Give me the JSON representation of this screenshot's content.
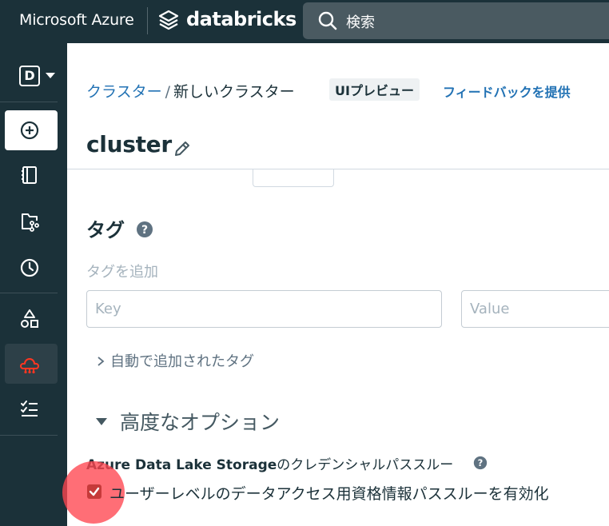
{
  "topbar": {
    "microsoft_azure": "Microsoft Azure",
    "databricks": "databricks",
    "search_placeholder": "検索"
  },
  "sidebar": {
    "workspace_initial": "D",
    "items": [
      {
        "icon": "plus-circle-icon",
        "selected": "create"
      },
      {
        "icon": "notebook-icon"
      },
      {
        "icon": "repos-icon"
      },
      {
        "icon": "clock-icon"
      },
      {
        "icon": "shapes-icon"
      },
      {
        "icon": "cluster-icon",
        "selected": "active"
      },
      {
        "icon": "checklist-icon"
      }
    ]
  },
  "header": {
    "breadcrumb_clusters": "クラスター",
    "breadcrumb_separator": "/",
    "breadcrumb_current": "新しいクラスター",
    "ui_preview": "UIプレビュー",
    "feedback": "フィードバックを提供",
    "title": "cluster"
  },
  "tags": {
    "title": "タグ",
    "subtitle": "タグを追加",
    "key_placeholder": "Key",
    "value_placeholder": "Value",
    "auto_added": "自動で追加されたタグ"
  },
  "advanced": {
    "title": "高度なオプション",
    "adls_bold": "Azure Data Lake Storage",
    "adls_rest": "のクレデンシャルパススルー",
    "checkbox_label": "ユーザーレベルのデータアクセス用資格情報パススルーを有効化",
    "checkbox_checked": true
  },
  "colors": {
    "navy": "#1b3139",
    "link": "#2272b4",
    "accent_red": "#ff3621",
    "highlight": "#ff454f"
  }
}
